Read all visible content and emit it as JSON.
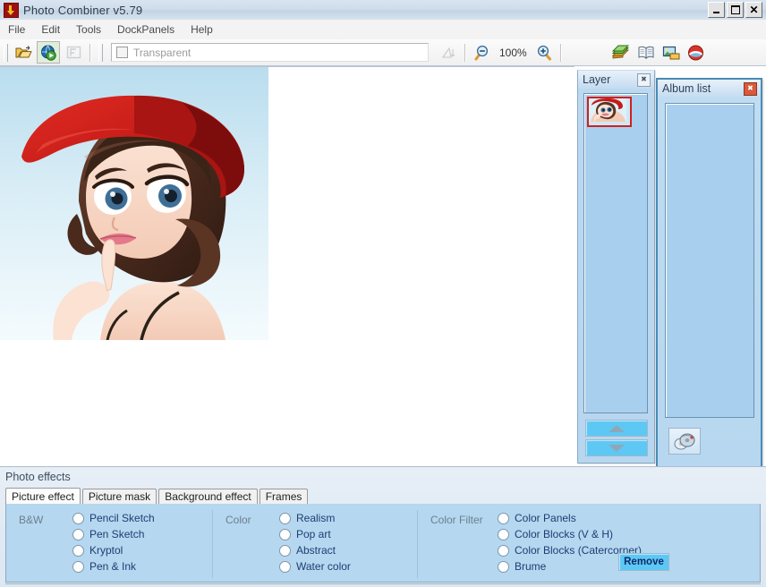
{
  "window": {
    "title": "Photo Combiner v5.79",
    "app_icon": "app-logo-icon",
    "controls": {
      "minimize": "_",
      "maximize": "□",
      "close": "✕"
    }
  },
  "menu": {
    "items": [
      {
        "label": "File"
      },
      {
        "label": "Edit"
      },
      {
        "label": "Tools"
      },
      {
        "label": "DockPanels"
      },
      {
        "label": "Help"
      }
    ]
  },
  "toolbar": {
    "open_icon": "open-folder-icon",
    "combine_icon": "green-globe-play-icon",
    "frame_icon": "frame-f-icon",
    "transparent": {
      "label": "Transparent",
      "checked": false
    },
    "shape_icon": "triangle-shape-icon",
    "zoom_out_icon": "zoom-out-icon",
    "zoom_level": "100%",
    "zoom_in_icon": "zoom-in-icon",
    "albums_icon": "green-books-icon",
    "book_icon": "open-book-icon",
    "picture_icon": "picture-folder-icon",
    "about_icon": "red-white-circle-icon"
  },
  "layer_panel": {
    "title": "Layer",
    "close_icon": "close-icon",
    "thumbnail_alt": "red-hat-girl-thumbnail",
    "move_up_icon": "arrow-up-icon",
    "move_down_icon": "arrow-down-icon"
  },
  "album_panel": {
    "title": "Album list",
    "close_icon": "close-icon",
    "add_album_icon": "album-disc-icon"
  },
  "floating_close": {
    "icon": "close-icon"
  },
  "effects": {
    "title": "Photo effects",
    "tabs": [
      {
        "label": "Picture effect",
        "active": true
      },
      {
        "label": "Picture mask",
        "active": false
      },
      {
        "label": "Background effect",
        "active": false
      },
      {
        "label": "Frames",
        "active": false
      }
    ],
    "groups": [
      {
        "label": "B&W",
        "options": [
          {
            "label": "Pencil Sketch",
            "selected": false
          },
          {
            "label": "Pen Sketch",
            "selected": false
          },
          {
            "label": "Kryptol",
            "selected": false
          },
          {
            "label": "Pen & Ink",
            "selected": false
          }
        ]
      },
      {
        "label": "Color",
        "options": [
          {
            "label": "Realism",
            "selected": false
          },
          {
            "label": "Pop art",
            "selected": false
          },
          {
            "label": "Abstract",
            "selected": false
          },
          {
            "label": "Water color",
            "selected": false
          }
        ]
      },
      {
        "label": "Color Filter",
        "options": [
          {
            "label": "Color Panels",
            "selected": false
          },
          {
            "label": "Color Blocks (V & H)",
            "selected": false
          },
          {
            "label": "Color Blocks (Catercorner)",
            "selected": false
          },
          {
            "label": "Brume",
            "selected": false
          }
        ]
      }
    ],
    "remove_button": "Remove"
  },
  "canvas": {
    "image_alt": "illustration-girl-red-hat",
    "background_color": "#ffffff"
  },
  "colors": {
    "panel_blue": "#b5d7f0",
    "accent_blue": "#5ec8f5",
    "title_gradient_start": "#d9e4ef",
    "radio_text": "#1c3f72"
  }
}
